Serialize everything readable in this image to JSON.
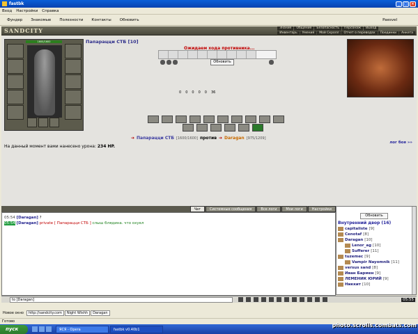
{
  "window": {
    "title": "fastbk"
  },
  "menu": [
    "Вход",
    "Настройки",
    "Справка"
  ],
  "toolbar": {
    "items": [
      "Фундер",
      "Знакомые",
      "Полезности",
      "Контакты",
      "Обновить"
    ],
    "right": "Paesvel"
  },
  "game": {
    "logo": "SANDCITY",
    "nav_top": [
      "Знание",
      "Общение",
      "Безопасность",
      "Персонаж",
      "Выход"
    ],
    "nav_bottom": [
      "Инвентарь",
      "Умения",
      "Мой Скролл",
      "Отчет о переводах",
      "Поединки",
      "Анкета"
    ],
    "hp": "1600/1600",
    "player_name": "Папарацци СТБ [10]",
    "waiting": "Ожидаем хода противника...",
    "refresh": "Обновить",
    "stats": [
      "0",
      "0",
      "0",
      "0",
      "0",
      "36"
    ],
    "fight": {
      "p1": "Папарацци СТБ",
      "p1_hp": "[1600/1600]",
      "vs": "против",
      "p2": "Daragan",
      "p2_hp": "[975/1209]"
    },
    "damage_text": "На данный момент вами нанесено урона:",
    "damage_value": "234 HP.",
    "log_link": "лог боя »»"
  },
  "tabs": [
    "Чат",
    "Системные сообщения",
    "Все логи",
    "Мои логи",
    "Настройки"
  ],
  "chat": [
    {
      "time": "05:54",
      "who": "[Daragan]",
      "text": "?"
    },
    {
      "time": "05:54",
      "who": "[Daragan]",
      "priv": "private [ Папарацци СТБ ]",
      "text": "слыш блядина. что охуел"
    }
  ],
  "side": {
    "refresh": "Обновить",
    "title": "Внутренний двор (16)",
    "users": [
      {
        "name": "capitaliste",
        "lvl": "[9]"
      },
      {
        "name": "Cenotaf",
        "lvl": "[8]"
      },
      {
        "name": "Daragan",
        "lvl": "[10]"
      },
      {
        "name": "Lenor_ag",
        "lvl": "[10]"
      },
      {
        "name": "Sufferer",
        "lvl": "[11]"
      },
      {
        "name": "tuzemec",
        "lvl": "[9]"
      },
      {
        "name": "Vampir Nayomnik",
        "lvl": "[11]"
      },
      {
        "name": "versus sand",
        "lvl": "[8]"
      },
      {
        "name": "Иван Бармен",
        "lvl": "[9]"
      },
      {
        "name": "ЛЕМЕНИК ЮРИЙ",
        "lvl": "[9]"
      },
      {
        "name": "Никкит",
        "lvl": "[10]"
      }
    ]
  },
  "input": {
    "value": "to [Daragan]"
  },
  "clock": "05:55",
  "address": {
    "label": "Новое окно",
    "url": "http://sandcity.com",
    "box2": "Night Wishh",
    "box3": "Daragan"
  },
  "status": "Готово",
  "taskbar": {
    "start": "пуск",
    "tasks": [
      "ЯСЯ - Opera",
      "fastbk v0.40b1"
    ]
  },
  "watermark": "photo.scrolls.combats.com"
}
